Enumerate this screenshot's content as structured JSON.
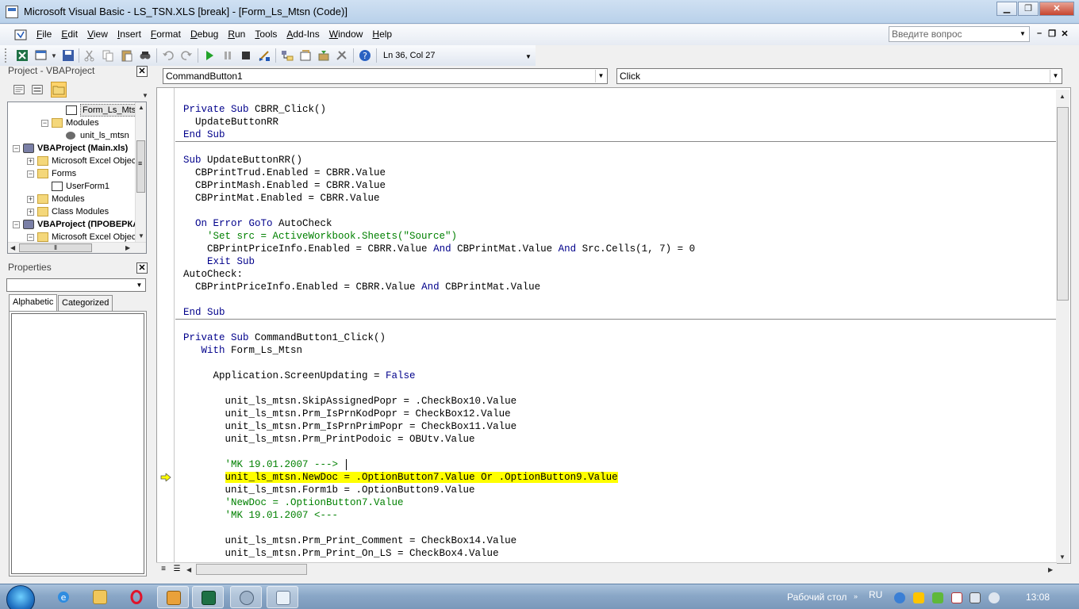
{
  "window": {
    "title": "Microsoft Visual Basic - LS_TSN.XLS [break] - [Form_Ls_Mtsn (Code)]"
  },
  "menu": [
    "File",
    "Edit",
    "View",
    "Insert",
    "Format",
    "Debug",
    "Run",
    "Tools",
    "Add-Ins",
    "Window",
    "Help"
  ],
  "help_search": {
    "placeholder": "Введите вопрос"
  },
  "toolbar": {
    "position": "Ln 36, Col 27"
  },
  "project": {
    "title": "Project - VBAProject",
    "tree": [
      {
        "label": "Form_Ls_Mtsn",
        "icon": "form-icon",
        "indent": 3,
        "selected": true
      },
      {
        "label": "Modules",
        "icon": "folder-icon",
        "indent": 2,
        "expander": "−"
      },
      {
        "label": "unit_ls_mtsn",
        "icon": "module-icon",
        "indent": 3
      },
      {
        "label": "VBAProject (Main.xls)",
        "icon": "project-icon",
        "indent": 0,
        "expander": "−",
        "bold": true
      },
      {
        "label": "Microsoft Excel Objects",
        "icon": "folder-icon",
        "indent": 1,
        "expander": "+"
      },
      {
        "label": "Forms",
        "icon": "folder-icon",
        "indent": 1,
        "expander": "−"
      },
      {
        "label": "UserForm1",
        "icon": "form-icon",
        "indent": 2
      },
      {
        "label": "Modules",
        "icon": "folder-icon",
        "indent": 1,
        "expander": "+"
      },
      {
        "label": "Class Modules",
        "icon": "folder-icon",
        "indent": 1,
        "expander": "+"
      },
      {
        "label": "VBAProject (ПРОВЕРКА.xls)",
        "icon": "project-icon",
        "indent": 0,
        "expander": "−",
        "bold": true
      },
      {
        "label": "Microsoft Excel Objects",
        "icon": "folder-icon",
        "indent": 1,
        "expander": "−"
      }
    ]
  },
  "properties": {
    "title": "Properties",
    "tabs": [
      "Alphabetic",
      "Categorized"
    ]
  },
  "code": {
    "object_combo": "CommandButton1",
    "proc_combo": "Click",
    "current_line_index": 30,
    "lines": [
      [],
      [
        {
          "t": "Private Sub",
          "k": "kw"
        },
        {
          "t": " CBRR_Click()"
        }
      ],
      [
        {
          "t": "  UpdateButtonRR"
        }
      ],
      [
        {
          "t": "End Sub",
          "k": "kw"
        }
      ],
      [],
      [
        {
          "t": "Sub",
          "k": "kw"
        },
        {
          "t": " UpdateButtonRR()"
        }
      ],
      [
        {
          "t": "  CBPrintTrud.Enabled = CBRR.Value"
        }
      ],
      [
        {
          "t": "  CBPrintMash.Enabled = CBRR.Value"
        }
      ],
      [
        {
          "t": "  CBPrintMat.Enabled = CBRR.Value"
        }
      ],
      [],
      [
        {
          "t": "  "
        },
        {
          "t": "On Error GoTo",
          "k": "kw"
        },
        {
          "t": " AutoCheck"
        }
      ],
      [
        {
          "t": "    'Set src = ActiveWorkbook.Sheets(\"Source\")",
          "k": "cm"
        }
      ],
      [
        {
          "t": "    CBPrintPriceInfo.Enabled = CBRR.Value "
        },
        {
          "t": "And",
          "k": "kw"
        },
        {
          "t": " CBPrintMat.Value "
        },
        {
          "t": "And",
          "k": "kw"
        },
        {
          "t": " Src.Cells(1, 7) = 0"
        }
      ],
      [
        {
          "t": "    "
        },
        {
          "t": "Exit Sub",
          "k": "kw"
        }
      ],
      [
        {
          "t": "AutoCheck:"
        }
      ],
      [
        {
          "t": "  CBPrintPriceInfo.Enabled = CBRR.Value "
        },
        {
          "t": "And",
          "k": "kw"
        },
        {
          "t": " CBPrintMat.Value"
        }
      ],
      [],
      [
        {
          "t": "End Sub",
          "k": "kw"
        }
      ],
      [],
      [
        {
          "t": "Private Sub",
          "k": "kw"
        },
        {
          "t": " CommandButton1_Click()"
        }
      ],
      [
        {
          "t": "   "
        },
        {
          "t": "With",
          "k": "kw"
        },
        {
          "t": " Form_Ls_Mtsn"
        }
      ],
      [],
      [
        {
          "t": "     Application.ScreenUpdating = "
        },
        {
          "t": "False",
          "k": "kw"
        }
      ],
      [],
      [
        {
          "t": "       unit_ls_mtsn.SkipAssignedPopr = .CheckBox10.Value"
        }
      ],
      [
        {
          "t": "       unit_ls_mtsn.Prm_IsPrnKodPopr = CheckBox12.Value"
        }
      ],
      [
        {
          "t": "       unit_ls_mtsn.Prm_IsPrnPrimPopr = CheckBox11.Value"
        }
      ],
      [
        {
          "t": "       unit_ls_mtsn.Prm_PrintPodoic = OBUtv.Value"
        }
      ],
      [],
      [
        {
          "t": "       'MK 19.01.2007 --->",
          "k": "cm"
        }
      ],
      [
        {
          "t": "       "
        },
        {
          "t": "unit_ls_mtsn.NewDoc = .OptionButton7.Value Or .OptionButton9.Value",
          "k": "hl"
        }
      ],
      [
        {
          "t": "       unit_ls_mtsn.Form1b = .OptionButton9.Value"
        }
      ],
      [
        {
          "t": "       'NewDoc = .OptionButton7.Value",
          "k": "cm"
        }
      ],
      [
        {
          "t": "       'MK 19.01.2007 <---",
          "k": "cm"
        }
      ],
      [],
      [
        {
          "t": "       unit_ls_mtsn.Prm_Print_Comment = CheckBox14.Value"
        }
      ],
      [
        {
          "t": "       unit_ls_mtsn.Prm_Print_On_LS = CheckBox4.Value"
        }
      ]
    ]
  },
  "taskbar": {
    "desktop_label": "Рабочий стол",
    "lang": "RU",
    "time": "13:08"
  }
}
